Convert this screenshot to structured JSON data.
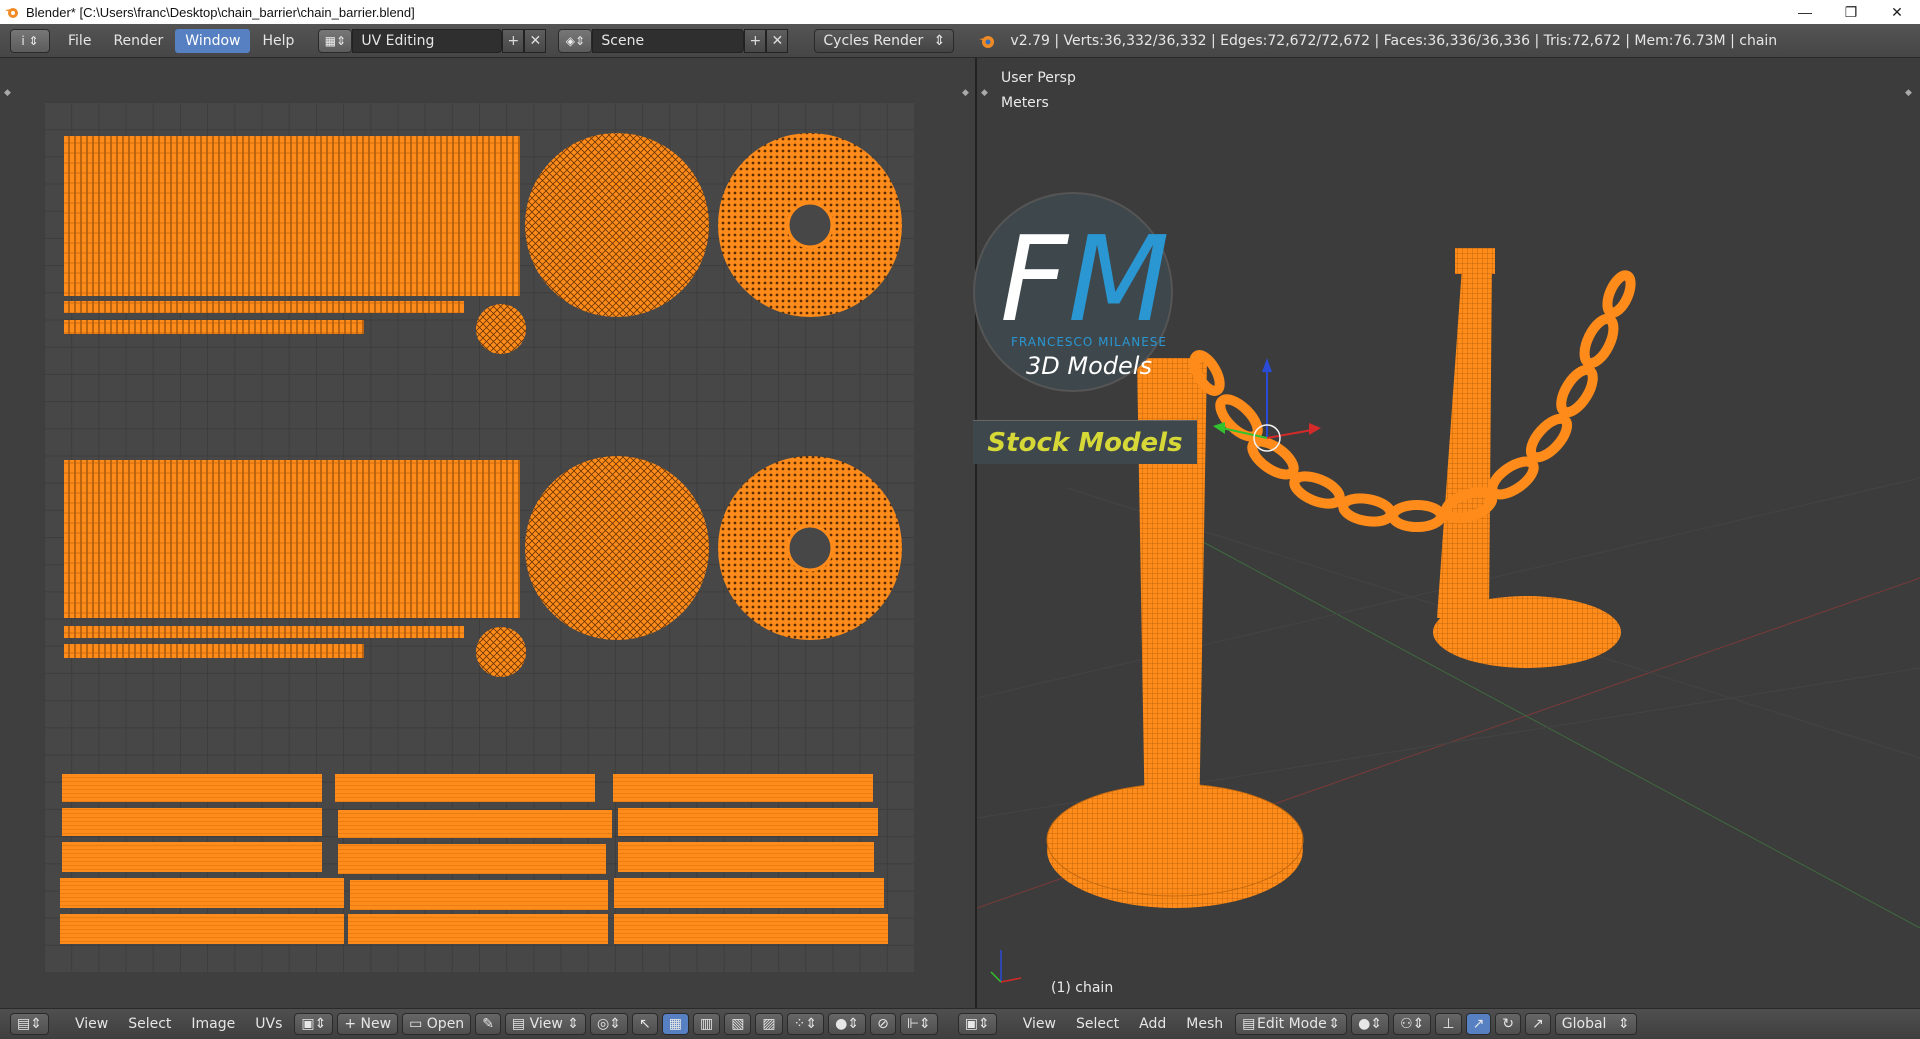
{
  "window": {
    "title": "Blender* [C:\\Users\\franc\\Desktop\\chain_barrier\\chain_barrier.blend]",
    "minimize": "—",
    "maximize": "❐",
    "close": "✕"
  },
  "topbar": {
    "info_icon": "i",
    "menus": [
      "File",
      "Render",
      "Window",
      "Help"
    ],
    "active_menu": "Window",
    "layout_field": "UV Editing",
    "scene_field": "Scene",
    "render_engine": "Cycles Render",
    "stats": "v2.79 | Verts:36,332/36,332 | Edges:72,672/72,672 | Faces:36,336/36,336 | Tris:72,672 | Mem:76.73M | chain",
    "add_symbol": "+",
    "remove_symbol": "✕"
  },
  "viewport": {
    "view_name": "User Persp",
    "units": "Meters",
    "object_label": "(1) chain"
  },
  "logo": {
    "letter_f": "F",
    "letter_m": "M",
    "name": "FRANCESCO MILANESE",
    "subtitle": "3D Models",
    "banner": "Stock Models",
    "colors": {
      "blue": "#2a97d3",
      "yellow": "#d6d838",
      "badge": "#3e474b"
    }
  },
  "uv_bottombar": {
    "items": [
      "View",
      "Select",
      "Image",
      "UVs"
    ],
    "new_label": "New",
    "open_label": "Open",
    "view_label": "View"
  },
  "viewport_bottombar": {
    "items": [
      "View",
      "Select",
      "Add",
      "Mesh"
    ],
    "mode": "Edit Mode",
    "orientation": "Global"
  },
  "colors": {
    "mesh": "#ff8c1a",
    "accent": "#5680c2"
  }
}
